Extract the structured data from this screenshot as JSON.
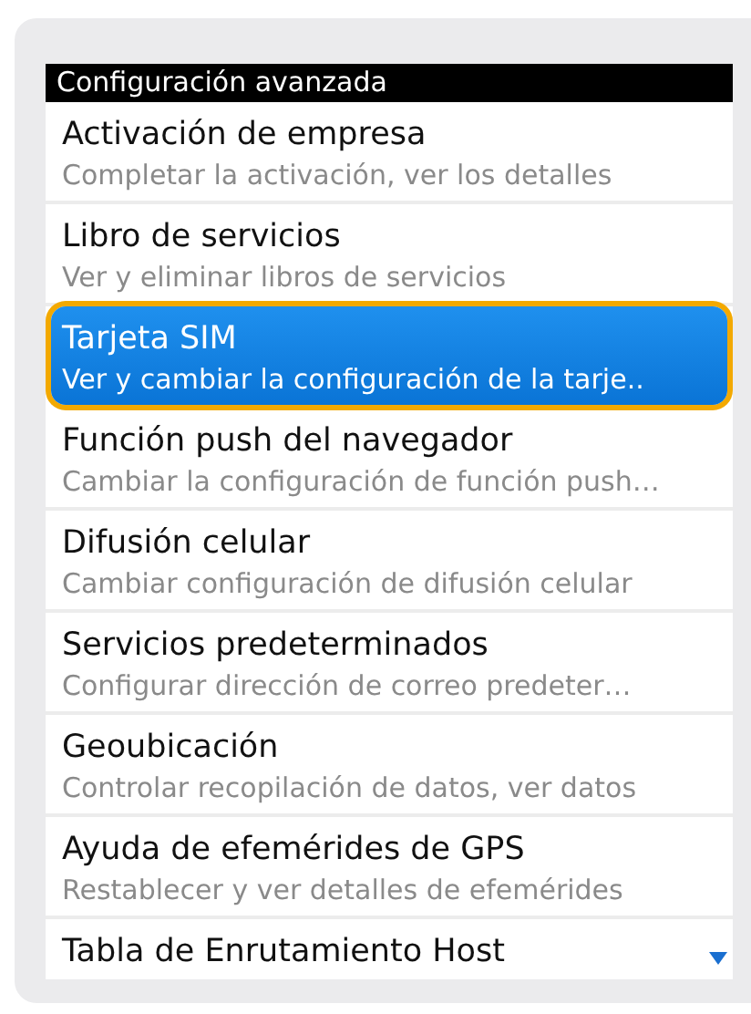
{
  "header": {
    "title": "Configuración avanzada"
  },
  "items": [
    {
      "title": "Activación de empresa",
      "subtitle": "Completar la activación, ver los detalles",
      "selected": false
    },
    {
      "title": "Libro de servicios",
      "subtitle": "Ver y eliminar libros de servicios",
      "selected": false
    },
    {
      "title": "Tarjeta SIM",
      "subtitle": "Ver y cambiar la configuración de la tarje..",
      "selected": true
    },
    {
      "title": "Función push del navegador",
      "subtitle": "Cambiar la configuración de función push…",
      "selected": false
    },
    {
      "title": "Difusión celular",
      "subtitle": "Cambiar configuración de difusión celular",
      "selected": false
    },
    {
      "title": "Servicios predeterminados",
      "subtitle": "Configurar dirección de correo predeter…",
      "selected": false
    },
    {
      "title": "Geoubicación",
      "subtitle": "Controlar recopilación de datos, ver datos",
      "selected": false
    },
    {
      "title": "Ayuda de efemérides de GPS",
      "subtitle": "Restablecer y ver detalles de efemérides",
      "selected": false
    },
    {
      "title": "Tabla de Enrutamiento Host",
      "selected": false
    }
  ]
}
